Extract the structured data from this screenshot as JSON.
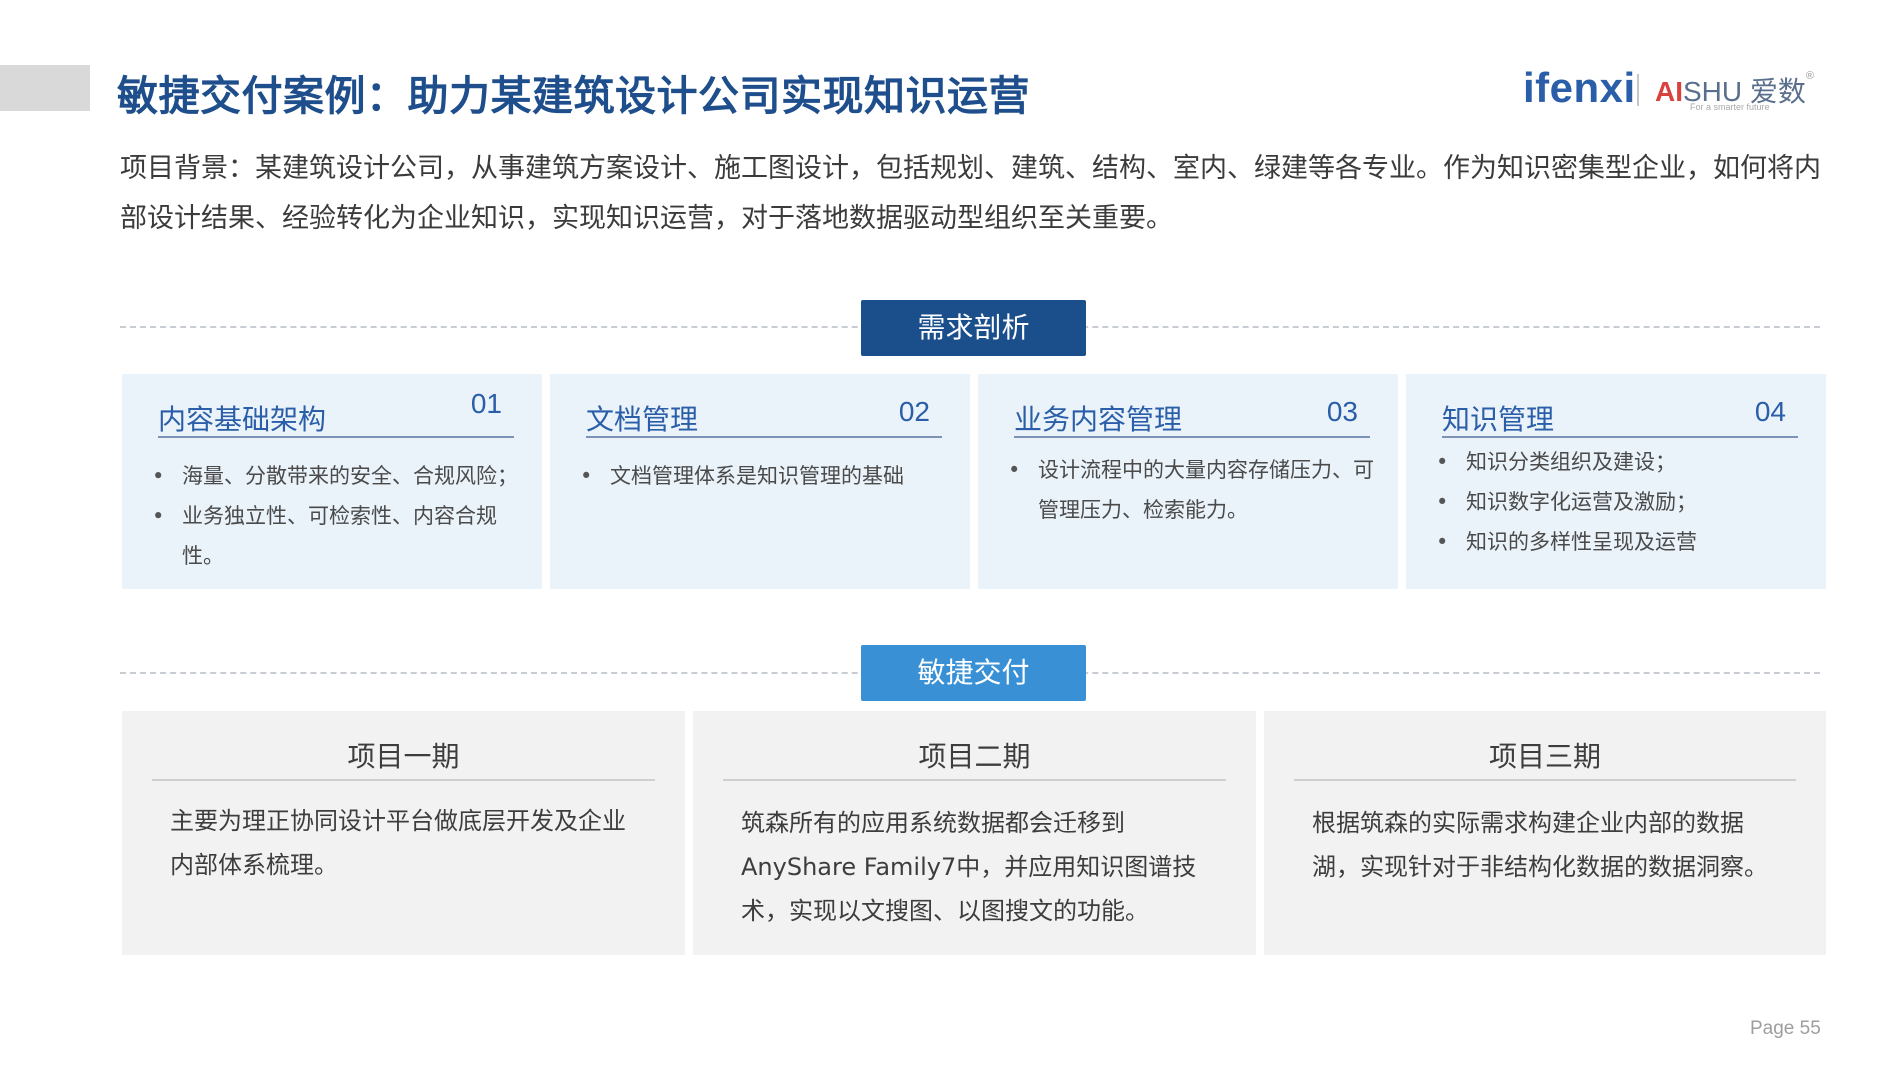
{
  "header": {
    "title": "敏捷交付案例：助力某建筑设计公司实现知识运营",
    "logo_ifenxi": "ifenxi",
    "logo_aishu_ai": "AI",
    "logo_aishu_shu": "SHU 爱数",
    "logo_aishu_tagline": "For a smarter future"
  },
  "intro": "项目背景：某建筑设计公司，从事建筑方案设计、施工图设计，包括规划、建筑、结构、室内、绿建等各专业。作为知识密集型企业，如何将内部设计结果、经验转化为企业知识，实现知识运营，对于落地数据驱动型组织至关重要。",
  "section_needs": {
    "label": "需求剖析",
    "cards": [
      {
        "title": "内容基础架构",
        "num": "01",
        "items": [
          "海量、分散带来的安全、合规风险；",
          "业务独立性、可检索性、内容合规性。"
        ]
      },
      {
        "title": "文档管理",
        "num": "02",
        "items": [
          "文档管理体系是知识管理的基础"
        ]
      },
      {
        "title": "业务内容管理",
        "num": "03",
        "items": [
          "设计流程中的大量内容存储压力、可管理压力、检索能力。"
        ]
      },
      {
        "title": "知识管理",
        "num": "04",
        "items": [
          "知识分类组织及建设；",
          "知识数字化运营及激励；",
          "知识的多样性呈现及运营"
        ]
      }
    ]
  },
  "section_delivery": {
    "label": "敏捷交付",
    "phases": [
      {
        "title": "项目一期",
        "text": "主要为理正协同设计平台做底层开发及企业内部体系梳理。"
      },
      {
        "title": "项目二期",
        "text": "筑森所有的应用系统数据都会迁移到AnyShare Family7中，并应用知识图谱技术，实现以文搜图、以图搜文的功能。"
      },
      {
        "title": "项目三期",
        "text": "根据筑森的实际需求构建企业内部的数据湖，实现针对于非结构化数据的数据洞察。"
      }
    ]
  },
  "footer": {
    "page": "Page  55"
  }
}
